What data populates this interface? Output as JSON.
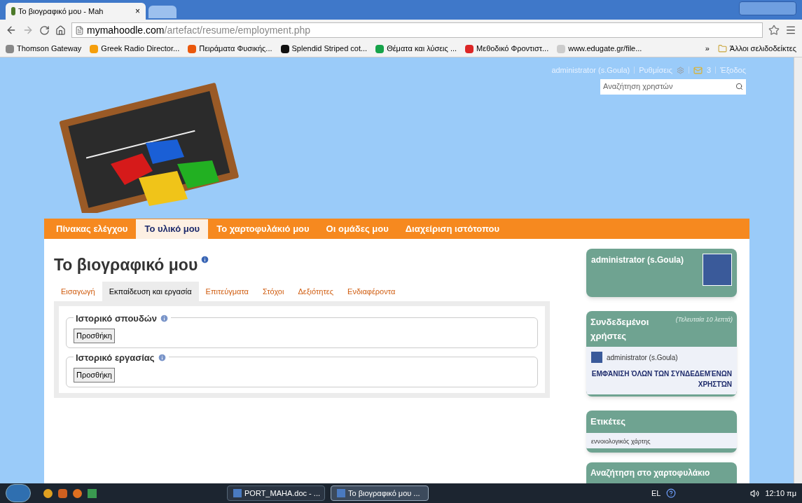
{
  "browser": {
    "tab_title": "Το βιογραφικό μου - Mah",
    "close": "×",
    "url_domain": "mymahoodle.com",
    "url_path": "/artefact/resume/employment.php",
    "bookmarks": [
      {
        "label": "Thomson Gateway"
      },
      {
        "label": "Greek Radio Director..."
      },
      {
        "label": "Πειράματα Φυσικής..."
      },
      {
        "label": "Splendid Striped cot..."
      },
      {
        "label": "Θέματα και λύσεις ..."
      },
      {
        "label": "Μεθοδικό Φροντιστ..."
      },
      {
        "label": "www.edugate.gr/file..."
      }
    ],
    "more": "»",
    "other_bookmarks": "Άλλοι σελιδοδείκτες"
  },
  "header": {
    "user_link": "administrator (s.Goula)",
    "settings": "Ρυθμίσεις",
    "messages_count": "3",
    "logout": "Έξοδος",
    "search_placeholder": "Αναζήτηση χρηστών"
  },
  "nav": [
    {
      "label": "Πίνακας ελέγχου",
      "selected": false
    },
    {
      "label": "Το υλικό μου",
      "selected": true
    },
    {
      "label": "Το χαρτοφυλάκιό μου",
      "selected": false
    },
    {
      "label": "Οι ομάδες μου",
      "selected": false
    },
    {
      "label": "Διαχείριση ιστότοπου",
      "selected": false
    }
  ],
  "page_title": "Το βιογραφικό μου",
  "tabs": [
    {
      "label": "Εισαγωγή",
      "selected": false
    },
    {
      "label": "Εκπαίδευση και εργασία",
      "selected": true
    },
    {
      "label": "Επιτεύγματα",
      "selected": false
    },
    {
      "label": "Στόχοι",
      "selected": false
    },
    {
      "label": "Δεξιότητες",
      "selected": false
    },
    {
      "label": "Ενδιαφέροντα",
      "selected": false
    }
  ],
  "sections": [
    {
      "legend": "Ιστορικό σπουδών",
      "button": "Προσθήκη"
    },
    {
      "legend": "Ιστορικό εργασίας",
      "button": "Προσθήκη"
    }
  ],
  "sidebar": {
    "profile_name": "administrator (s.Goula)",
    "online": {
      "title": "Συνδεδεμένοι χρήστες",
      "note": "(Τελευταία 10 λεπτά)",
      "users": [
        "administrator (s.Goula)"
      ],
      "show_all": "ΕΜΦΆΝΙΣΗ ΌΛΩΝ ΤΩΝ ΣΥΝΔΕΔΕΜΈΝΩΝ ΧΡΗΣΤΏΝ"
    },
    "tags": {
      "title": "Ετικέτες",
      "items": [
        "εννοιολογικός χάρτης"
      ]
    },
    "search_title": "Αναζήτηση στο χαρτοφυλάκιο"
  },
  "taskbar": {
    "tasks": [
      {
        "label": "PORT_MAHA.doc - ...",
        "selected": false
      },
      {
        "label": "Το βιογραφικό μου ...",
        "selected": true
      }
    ],
    "language": "EL",
    "clock": "12:10 πμ"
  }
}
